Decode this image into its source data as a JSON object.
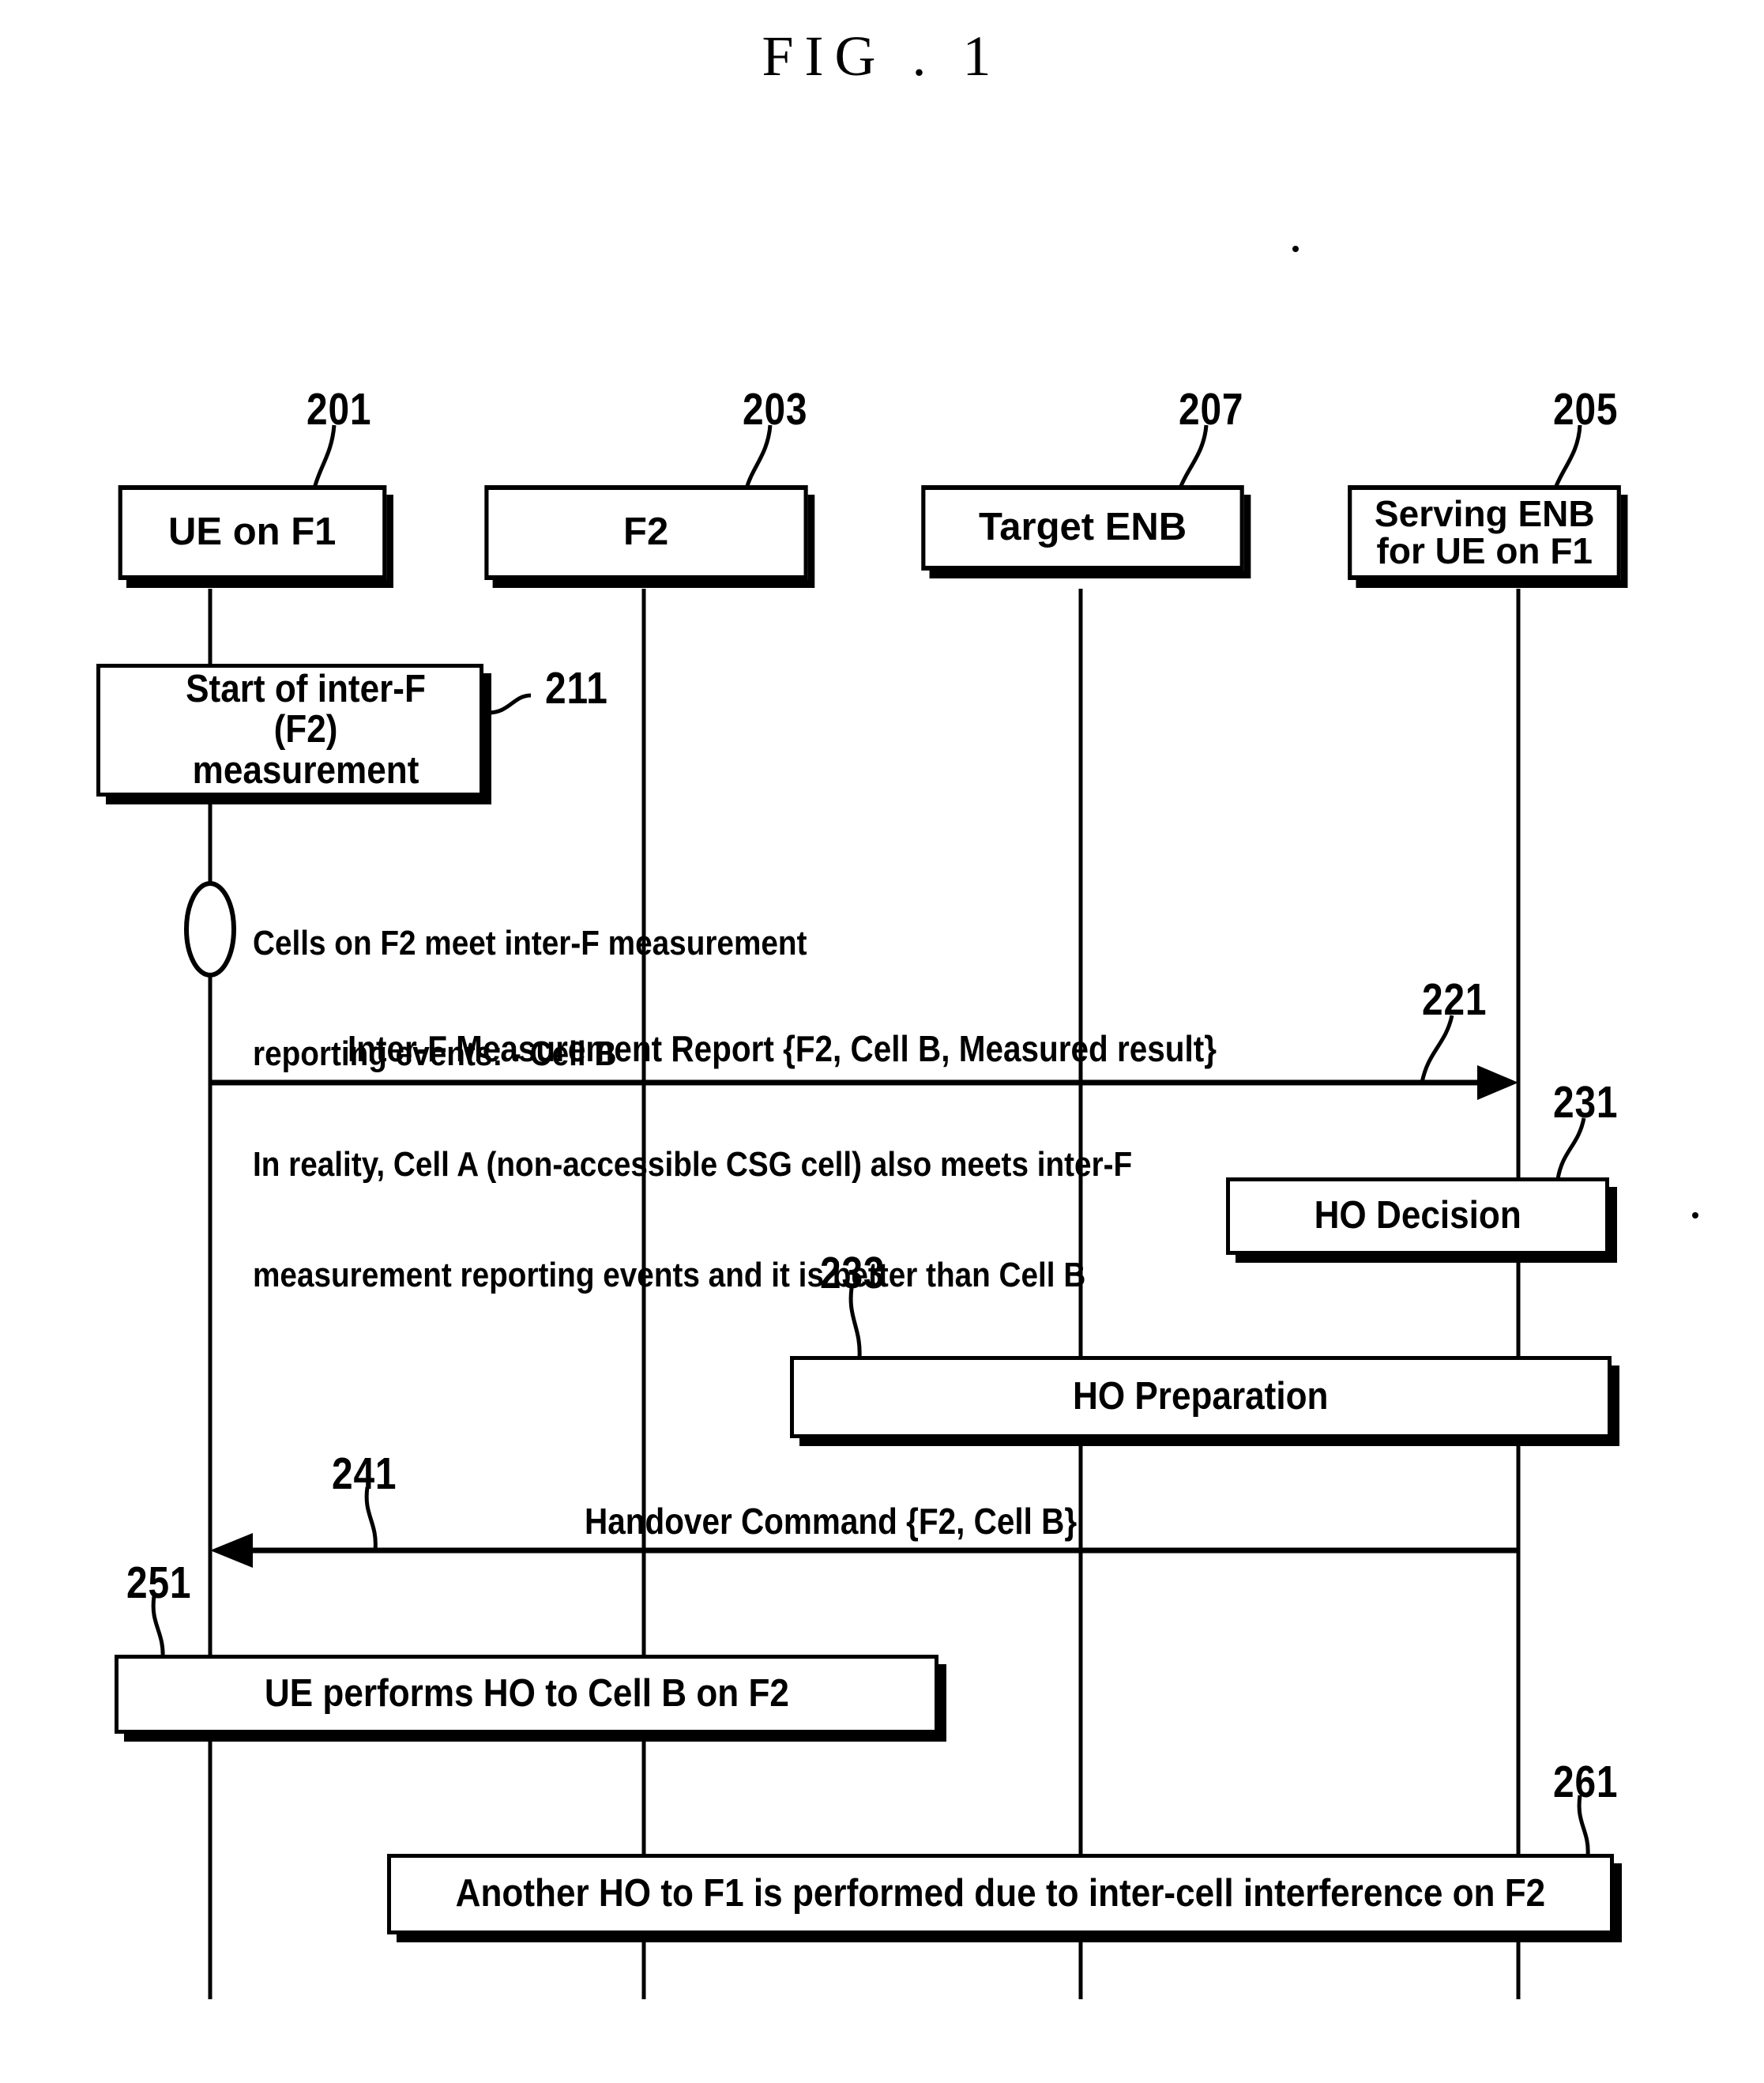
{
  "figure": {
    "title": "FIG . 1"
  },
  "actors": [
    {
      "id": "ue",
      "label": "UE on F1",
      "ref": "201"
    },
    {
      "id": "f2",
      "label": "F2",
      "ref": "203"
    },
    {
      "id": "target_enb",
      "label": "Target ENB",
      "ref": "207"
    },
    {
      "id": "serving_enb",
      "label_line1": "Serving ENB",
      "label_line2": "for UE on F1",
      "ref": "205"
    }
  ],
  "steps": {
    "start_measurement": {
      "line1": "Start of inter-F (F2)",
      "line2": "measurement",
      "ref": "211"
    },
    "ho_decision": {
      "label": "HO Decision",
      "ref": "231"
    },
    "ho_preparation": {
      "label": "HO Preparation",
      "ref": "233"
    },
    "ue_performs_ho": {
      "label": "UE performs HO to Cell B on F2",
      "ref": "251"
    },
    "another_ho": {
      "label": "Another HO to F1 is performed due to inter-cell interference on F2",
      "ref": "261"
    }
  },
  "annotation": {
    "line1": "Cells on F2 meet inter-F measurement",
    "line2": "reporting events: - Cell B",
    "line3": "In reality, Cell A (non-accessible CSG cell) also meets inter-F",
    "line4": "measurement reporting events and it is better than Cell B"
  },
  "messages": [
    {
      "id": "measurement_report",
      "label": "Inter-F Measurement Report {F2, Cell B, Measured result}",
      "ref": "221",
      "direction": "right"
    },
    {
      "id": "handover_command",
      "label": "Handover Command {F2, Cell B}",
      "ref": "241",
      "direction": "left"
    }
  ]
}
